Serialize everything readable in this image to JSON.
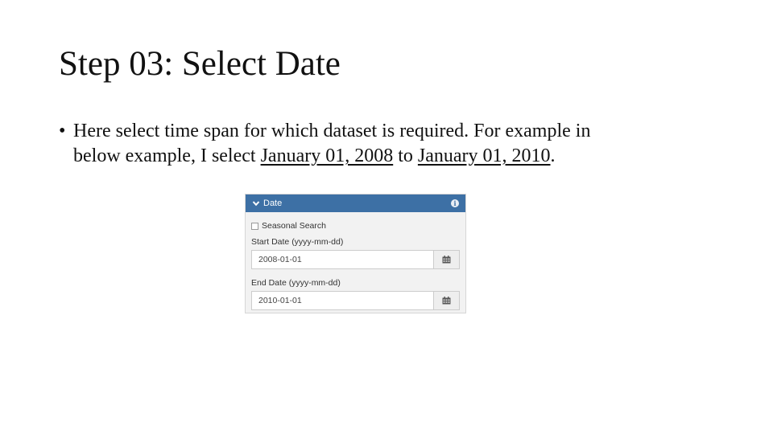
{
  "slide": {
    "title": "Step 03: Select Date",
    "bullet_marker": "•",
    "bullet_line1": "Here select time span for which dataset is required. For example in",
    "bullet_line2_prefix": "below example, I select ",
    "bullet_date_start": "January 01, 2008",
    "bullet_between": " to ",
    "bullet_date_end": "January 01, 2010",
    "bullet_end": "."
  },
  "panel": {
    "header_label": "Date",
    "header_icon": "chevron-down-icon",
    "info_icon": "info-icon",
    "info_glyph": "i",
    "header_color": "#3d70a5",
    "seasonal_label": "Seasonal Search",
    "seasonal_checked": false,
    "start_label": "Start Date (yyyy-mm-dd)",
    "start_value": "2008-01-01",
    "end_label": "End Date (yyyy-mm-dd)",
    "end_value": "2010-01-01",
    "calendar_icon": "calendar-icon"
  }
}
